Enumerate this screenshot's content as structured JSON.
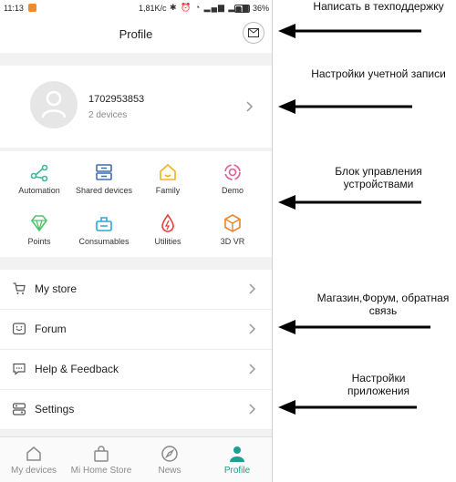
{
  "status_bar": {
    "time": "11:13",
    "speed": "1,81K/c",
    "battery": "36%"
  },
  "header": {
    "title": "Profile",
    "mail_icon": "mail-icon"
  },
  "account": {
    "id": "1702953853",
    "devices": "2 devices"
  },
  "grid": [
    {
      "label": "Automation",
      "icon": "automation-icon",
      "color": "#3cb59b"
    },
    {
      "label": "Shared devices",
      "icon": "shared-devices-icon",
      "color": "#3e6fb5"
    },
    {
      "label": "Family",
      "icon": "family-house-icon",
      "color": "#f3b21c"
    },
    {
      "label": "Demo",
      "icon": "demo-icon",
      "color": "#e05c9b"
    },
    {
      "label": "Points",
      "icon": "points-diamond-icon",
      "color": "#4fc36b"
    },
    {
      "label": "Consumables",
      "icon": "consumables-icon",
      "color": "#2aa9d6"
    },
    {
      "label": "Utilities",
      "icon": "utilities-drop-icon",
      "color": "#e2433a"
    },
    {
      "label": "3D VR",
      "icon": "vr-cube-icon",
      "color": "#e8862a"
    }
  ],
  "menu": [
    {
      "label": "My store",
      "icon": "cart-icon"
    },
    {
      "label": "Forum",
      "icon": "forum-icon"
    },
    {
      "label": "Help & Feedback",
      "icon": "feedback-icon"
    },
    {
      "label": "Settings",
      "icon": "settings-icon"
    }
  ],
  "tabs": [
    {
      "label": "My devices",
      "icon": "home-icon",
      "active": false
    },
    {
      "label": "Mi Home Store",
      "icon": "bag-icon",
      "active": false
    },
    {
      "label": "News",
      "icon": "compass-icon",
      "active": false
    },
    {
      "label": "Profile",
      "icon": "profile-icon",
      "active": true
    }
  ],
  "annotations": {
    "support": "Написать в техподдержку",
    "account": "Настройки учетной записи",
    "devices": "Блок управления устройствами",
    "store": "Магазин,Форум, обратная связь",
    "settings": "Настройки приложения"
  },
  "accent_color": "#1aa094"
}
